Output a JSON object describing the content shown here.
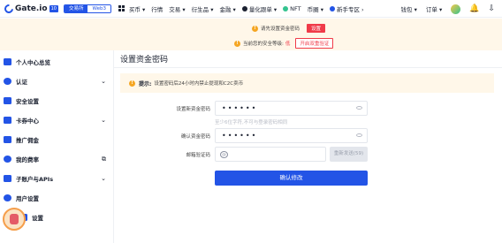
{
  "topnav": {
    "logo_text": "Gate.io",
    "logo_badge": "10",
    "toggle": {
      "active": "交易所",
      "inactive": "Web3"
    },
    "items": [
      "买币 ▾",
      "行情",
      "交易 ▾",
      "衍生品 ▾",
      "金融 ▾",
      "量化跟单 ▾",
      "NFT",
      "币圈 ▾",
      "新手专区 ›"
    ],
    "right_items": [
      "钱包 ▾",
      "订单 ▾"
    ]
  },
  "notice": {
    "line1_text": "请先设置资金密码",
    "line1_button": "设置",
    "line2_text": "当前您的安全等级:",
    "line2_level": "低",
    "line2_button": "开启双重验证"
  },
  "sidebar": {
    "items": [
      {
        "label": "个人中心总览"
      },
      {
        "label": "认证",
        "chevron": "⌄"
      },
      {
        "label": "安全设置"
      },
      {
        "label": "卡券中心",
        "chevron": "⌄"
      },
      {
        "label": "推广佣金"
      },
      {
        "label": "我的费率",
        "ext": "⧉"
      },
      {
        "label": "子账户与APIs",
        "chevron": "⌄"
      },
      {
        "label": "用户设置"
      },
      {
        "label": "设置"
      }
    ]
  },
  "main": {
    "title": "设置资金密码",
    "tip": {
      "strong": "提示:",
      "text": "设置密码后24小时内禁止提现和C2C卖币"
    },
    "form": {
      "new_password_label": "设置新资金密码",
      "new_password_value": "••••••",
      "hint": "至少6位字符,不可与登录密码相同",
      "confirm_label": "确认资金密码",
      "confirm_value": "••••••",
      "email_code_label": "邮箱验证码",
      "email_code_icon": "@",
      "send_button": "重新发送(59)",
      "submit_button": "确认修改"
    }
  },
  "colors": {
    "primary": "#2354e6",
    "danger": "#f03b49",
    "notice_bg": "#fff7e9"
  }
}
